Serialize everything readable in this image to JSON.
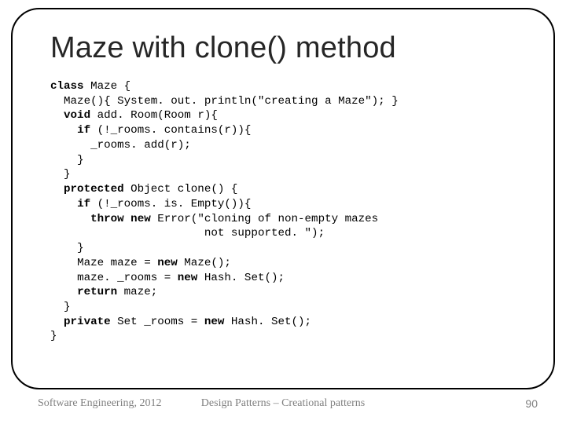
{
  "slide": {
    "title": "Maze with clone() method",
    "code_lines": [
      {
        "indent": 0,
        "segments": [
          {
            "t": "class ",
            "b": true
          },
          {
            "t": "Maze {"
          }
        ]
      },
      {
        "indent": 1,
        "segments": [
          {
            "t": "Maze(){ System. out. println(\"creating a Maze\"); }"
          }
        ]
      },
      {
        "indent": 1,
        "segments": [
          {
            "t": "void ",
            "b": true
          },
          {
            "t": "add. Room(Room r){"
          }
        ]
      },
      {
        "indent": 2,
        "segments": [
          {
            "t": "if ",
            "b": true
          },
          {
            "t": "(!_rooms. contains(r)){"
          }
        ]
      },
      {
        "indent": 3,
        "segments": [
          {
            "t": "_rooms. add(r);"
          }
        ]
      },
      {
        "indent": 2,
        "segments": [
          {
            "t": "}"
          }
        ]
      },
      {
        "indent": 1,
        "segments": [
          {
            "t": "}"
          }
        ]
      },
      {
        "indent": 1,
        "segments": [
          {
            "t": "protected ",
            "b": true
          },
          {
            "t": "Object clone() {"
          }
        ]
      },
      {
        "indent": 2,
        "segments": [
          {
            "t": "if ",
            "b": true
          },
          {
            "t": "(!_rooms. is. Empty()){"
          }
        ]
      },
      {
        "indent": 3,
        "segments": [
          {
            "t": "throw new ",
            "b": true
          },
          {
            "t": "Error(\"cloning of non-empty mazes"
          }
        ]
      },
      {
        "indent": 3,
        "segments": [
          {
            "t": "                 not supported. \");"
          }
        ]
      },
      {
        "indent": 2,
        "segments": [
          {
            "t": "}"
          }
        ]
      },
      {
        "indent": 2,
        "segments": [
          {
            "t": "Maze maze = "
          },
          {
            "t": "new ",
            "b": true
          },
          {
            "t": "Maze();"
          }
        ]
      },
      {
        "indent": 2,
        "segments": [
          {
            "t": "maze. _rooms = "
          },
          {
            "t": "new ",
            "b": true
          },
          {
            "t": "Hash. Set();"
          }
        ]
      },
      {
        "indent": 2,
        "segments": [
          {
            "t": "return ",
            "b": true
          },
          {
            "t": "maze;"
          }
        ]
      },
      {
        "indent": 1,
        "segments": [
          {
            "t": "}"
          }
        ]
      },
      {
        "indent": 1,
        "segments": [
          {
            "t": "private ",
            "b": true
          },
          {
            "t": "Set _rooms = "
          },
          {
            "t": "new ",
            "b": true
          },
          {
            "t": "Hash. Set();"
          }
        ]
      },
      {
        "indent": 0,
        "segments": [
          {
            "t": "}"
          }
        ]
      }
    ]
  },
  "footer": {
    "left": "Software Engineering, 2012",
    "center": "Design Patterns – Creational patterns",
    "right": "90"
  }
}
